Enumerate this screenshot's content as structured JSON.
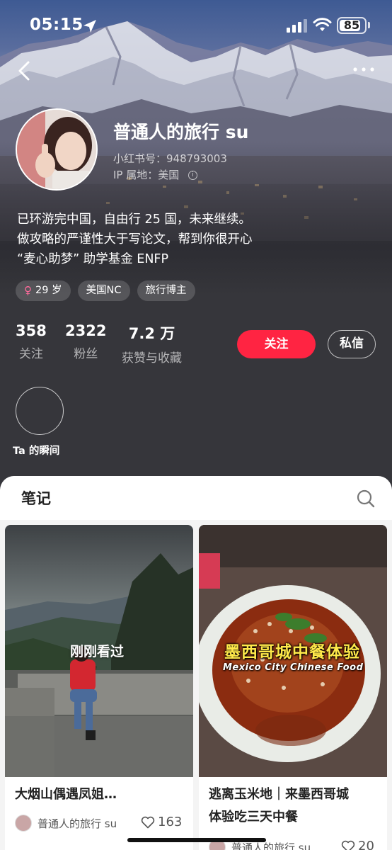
{
  "status_bar": {
    "time": "05:15",
    "battery": "85",
    "battery_level": 0.85
  },
  "profile": {
    "name": "普通人的旅行 su",
    "red_id": "小红书号：948793003",
    "ip_location": "IP 属地：美国",
    "bio": [
      "已环游完中国，自由行 25 国，未来继续。",
      "做攻略的严谨性大于写论文，帮到你很开心",
      "“麦心助梦” 助学基金 ENFP"
    ],
    "tags": [
      "29 岁",
      "美国NC",
      "旅行博主"
    ],
    "stats": [
      {
        "num": "358",
        "label": "关注"
      },
      {
        "num": "2322",
        "label": "粉丝"
      },
      {
        "num": "7.2 万",
        "label": "获赞与收藏"
      }
    ],
    "follow_label": "关注",
    "message_label": "私信",
    "moments_label": "Ta 的瞬间"
  },
  "notes": {
    "tab_label": "笔记",
    "cards": [
      {
        "title": "大烟山偶遇凤姐…",
        "author": "普通人的旅行 su",
        "likes": "163",
        "badge": "刚刚看过"
      },
      {
        "title_lines": [
          "逃离玉米地｜来墨西哥城",
          "体验吃三天中餐"
        ],
        "author": "普通人的旅行 su",
        "likes": "20",
        "overlay_title": "墨西哥城中餐体验",
        "overlay_sub": "Mexico City Chinese Food"
      }
    ]
  },
  "colors": {
    "accent": "#ff2442",
    "background": "#36363b"
  }
}
